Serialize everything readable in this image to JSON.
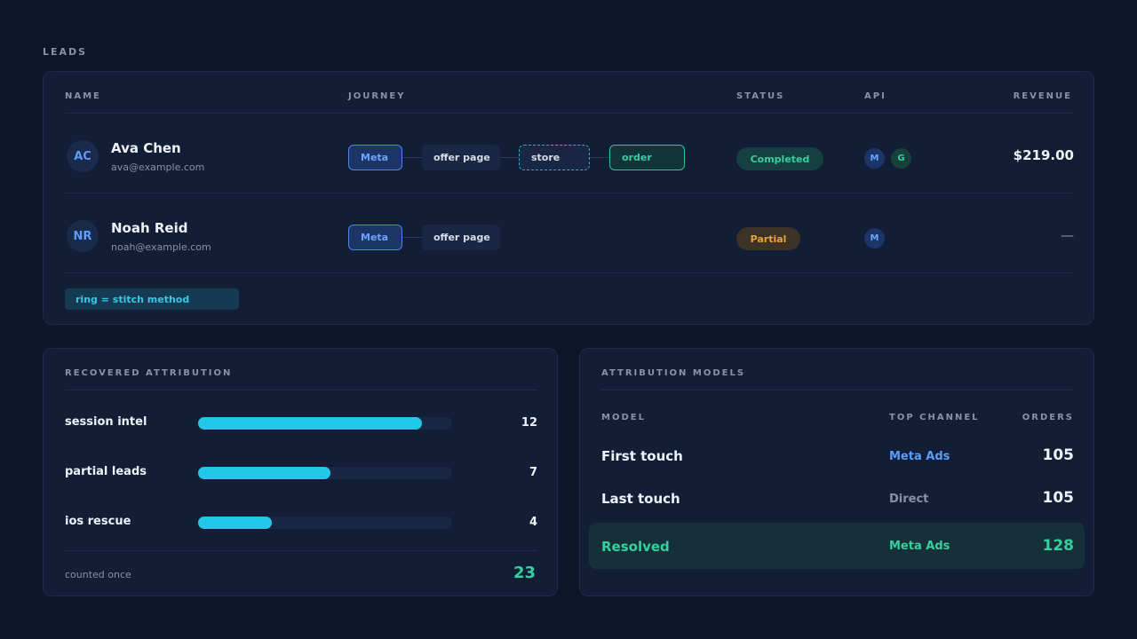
{
  "leads": {
    "section_title": "LEADS",
    "columns": [
      "NAME",
      "JOURNEY",
      "STATUS",
      "API",
      "REVENUE"
    ],
    "rows": [
      {
        "initials": "AC",
        "name": "Ava Chen",
        "email": "ava@example.com",
        "journey": [
          "Meta",
          "offer page",
          "store",
          "order"
        ],
        "status": "Completed",
        "api": [
          "M",
          "G"
        ],
        "revenue": "$219.00"
      },
      {
        "initials": "NR",
        "name": "Noah Reid",
        "email": "noah@example.com",
        "journey": [
          "Meta",
          "offer page"
        ],
        "status": "Partial",
        "api": [
          "M"
        ],
        "revenue": "—"
      }
    ],
    "legend": "ring = stitch method"
  },
  "recovered": {
    "title": "RECOVERED ATTRIBUTION",
    "items": [
      {
        "label": "session intel",
        "value": "12",
        "fraction": 0.88
      },
      {
        "label": "partial leads",
        "value": "7",
        "fraction": 0.52
      },
      {
        "label": "ios rescue",
        "value": "4",
        "fraction": 0.29
      }
    ],
    "footer_label": "counted once",
    "total": "23"
  },
  "models": {
    "title": "ATTRIBUTION MODELS",
    "columns": [
      "MODEL",
      "TOP CHANNEL",
      "ORDERS"
    ],
    "rows": [
      {
        "model": "First touch",
        "channel": "Meta Ads",
        "orders": "105"
      },
      {
        "model": "Last touch",
        "channel": "Direct",
        "orders": "105"
      },
      {
        "model": "Resolved",
        "channel": "Meta Ads",
        "orders": "128"
      }
    ]
  },
  "colors": {
    "background": "#0b1628",
    "card": "#111e35",
    "accent_blue": "#5b9dff",
    "accent_green": "#35d0a0",
    "accent_cyan": "#22c8ea",
    "accent_orange": "#f0a030"
  }
}
